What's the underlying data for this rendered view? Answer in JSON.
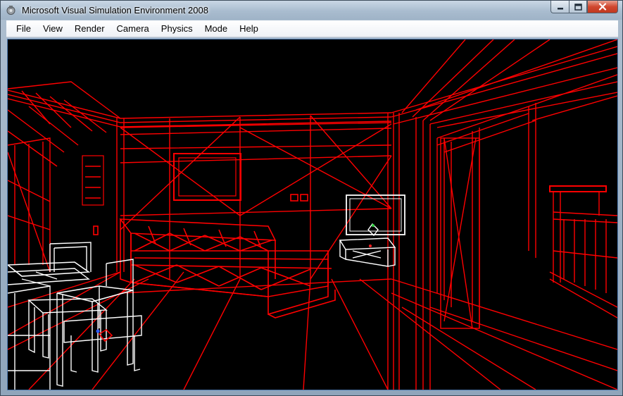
{
  "window": {
    "title": "Microsoft Visual Simulation Environment 2008"
  },
  "caption_buttons": [
    {
      "name": "minimize-button",
      "icon": "minimize-icon"
    },
    {
      "name": "maximize-button",
      "icon": "maximize-icon"
    },
    {
      "name": "close-button",
      "icon": "close-icon"
    }
  ],
  "menu": {
    "items": [
      {
        "key": "file",
        "label": "File"
      },
      {
        "key": "view",
        "label": "View"
      },
      {
        "key": "render",
        "label": "Render"
      },
      {
        "key": "camera",
        "label": "Camera"
      },
      {
        "key": "physics",
        "label": "Physics"
      },
      {
        "key": "mode",
        "label": "Mode"
      },
      {
        "key": "help",
        "label": "Help"
      }
    ]
  },
  "viewport": {
    "render_mode": "wireframe",
    "scene": "room interior",
    "colors": {
      "background": "#000000",
      "environment": "#ff0000",
      "entities": "#ffffff"
    }
  }
}
